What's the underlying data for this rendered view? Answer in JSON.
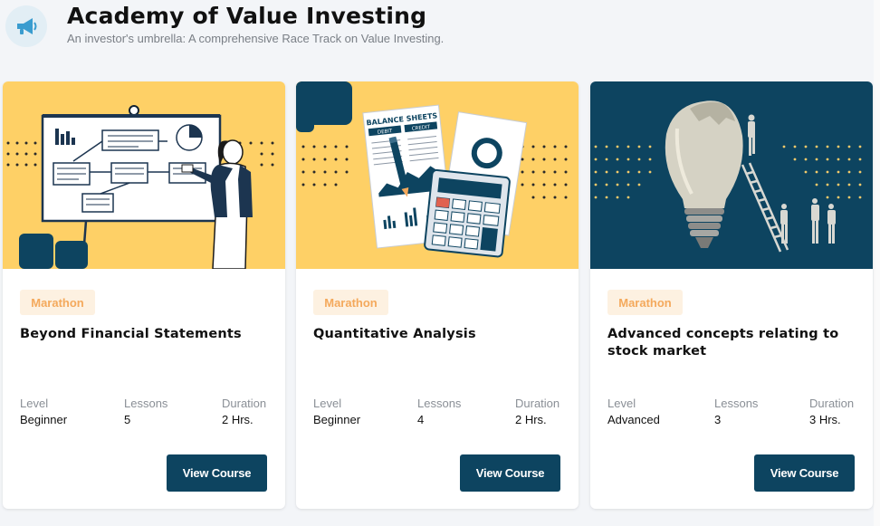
{
  "header": {
    "icon": "megaphone-icon",
    "title": "Academy of Value Investing",
    "subtitle": "An investor's umbrella: A comprehensive Race Track on Value Investing."
  },
  "colors": {
    "accent_dark": "#0d4460",
    "card_yellow": "#fed066",
    "badge_bg": "#fdf1e1",
    "badge_text": "#f4a95c"
  },
  "courses": [
    {
      "badge": "Marathon",
      "title": "Beyond Financial Statements",
      "level_label": "Level",
      "level": "Beginner",
      "lessons_label": "Lessons",
      "lessons": "5",
      "duration_label": "Duration",
      "duration": "2 Hrs.",
      "button": "View Course"
    },
    {
      "badge": "Marathon",
      "title": "Quantitative Analysis",
      "level_label": "Level",
      "level": "Beginner",
      "lessons_label": "Lessons",
      "lessons": "4",
      "duration_label": "Duration",
      "duration": "2 Hrs.",
      "button": "View Course",
      "image_text": {
        "sheet": "BALANCE SHEETS",
        "debit": "DEBIT",
        "credit": "CREDIT"
      }
    },
    {
      "badge": "Marathon",
      "title": "Advanced concepts relating to stock market",
      "level_label": "Level",
      "level": "Advanced",
      "lessons_label": "Lessons",
      "lessons": "3",
      "duration_label": "Duration",
      "duration": "3 Hrs.",
      "button": "View Course"
    }
  ]
}
